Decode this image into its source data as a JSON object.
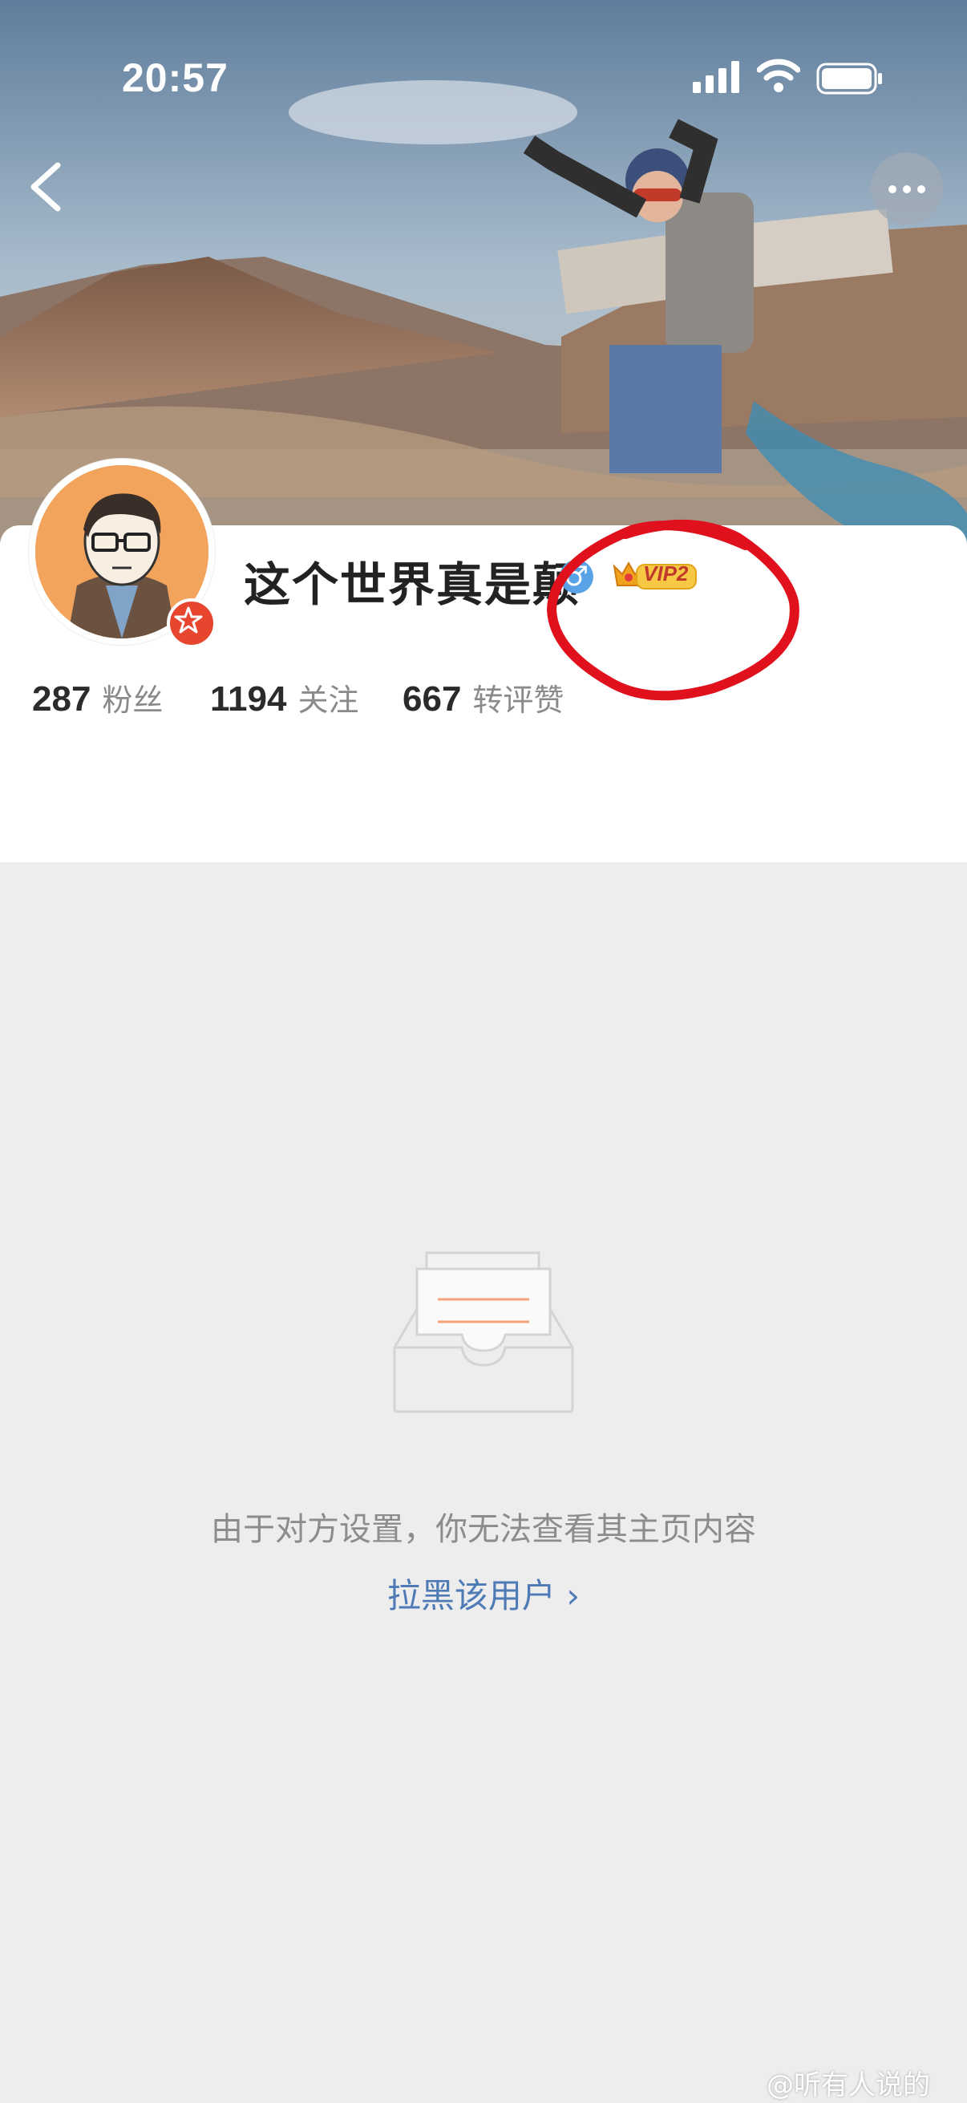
{
  "status_bar": {
    "time": "20:57"
  },
  "profile": {
    "name": "这个世界真是颠",
    "gender_symbol": "♂",
    "vip_label": "VIP2"
  },
  "stats": [
    {
      "value": "287",
      "label": "粉丝"
    },
    {
      "value": "1194",
      "label": "关注"
    },
    {
      "value": "667",
      "label": "转评赞"
    }
  ],
  "empty_state": {
    "message": "由于对方设置，你无法查看其主页内容",
    "block_link": "拉黑该用户 ›"
  },
  "watermark": "@听有人说的",
  "colors": {
    "accent_link": "#4e7ab6",
    "annotation_red": "#e0101c",
    "avatar_badge": "#e8452f"
  }
}
